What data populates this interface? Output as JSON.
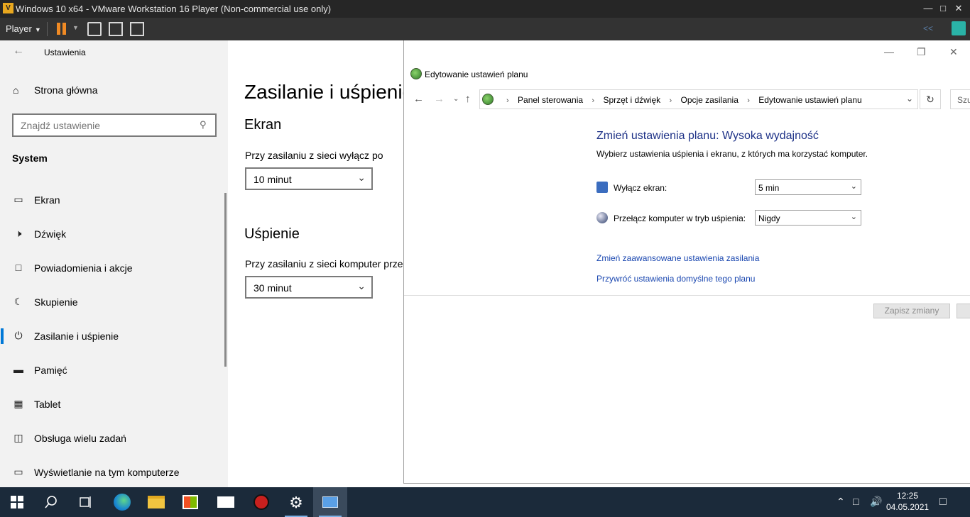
{
  "vmware": {
    "title": "Windows 10 x64 - VMware Workstation 16 Player (Non-commercial use only)",
    "player_menu": "Player",
    "collapse_glyph": "<<"
  },
  "settings": {
    "app_title": "Ustawienia",
    "home": "Strona główna",
    "search_placeholder": "Znajdź ustawienie",
    "section": "System",
    "nav": [
      {
        "label": "Ekran",
        "icon": "monitor-icon"
      },
      {
        "label": "Dźwięk",
        "icon": "speaker-icon"
      },
      {
        "label": "Powiadomienia i akcje",
        "icon": "notification-icon"
      },
      {
        "label": "Skupienie",
        "icon": "moon-icon"
      },
      {
        "label": "Zasilanie i uśpienie",
        "icon": "power-icon",
        "active": true
      },
      {
        "label": "Pamięć",
        "icon": "storage-icon"
      },
      {
        "label": "Tablet",
        "icon": "tablet-icon"
      },
      {
        "label": "Obsługa wielu zadań",
        "icon": "multitasking-icon"
      },
      {
        "label": "Wyświetlanie na tym komputerze",
        "icon": "project-icon"
      }
    ],
    "page_title": "Zasilanie i uśpienie",
    "screen_header": "Ekran",
    "screen_label": "Przy zasilaniu z sieci wyłącz po",
    "screen_value": "10 minut",
    "sleep_header": "Uśpienie",
    "sleep_label": "Przy zasilaniu z sieci komputer przec",
    "sleep_value": "30 minut"
  },
  "control_panel": {
    "window_title": "Edytowanie ustawień planu",
    "breadcrumbs": [
      "Panel sterowania",
      "Sprzęt i dźwięk",
      "Opcje zasilania",
      "Edytowanie ustawień planu"
    ],
    "search_placeholder": "Szu",
    "heading": "Zmień ustawienia planu: Wysoka wydajność",
    "subheading": "Wybierz ustawienia uśpienia i ekranu, z których ma korzystać komputer.",
    "display_off_label": "Wyłącz ekran:",
    "display_off_value": "5 min",
    "sleep_label": "Przełącz komputer w tryb uśpienia:",
    "sleep_value": "Nigdy",
    "link_advanced": "Zmień zaawansowane ustawienia zasilania",
    "link_restore": "Przywróć ustawienia domyślne tego planu",
    "save_button": "Zapisz zmiany"
  },
  "taskbar": {
    "time": "12:25",
    "date": "04.05.2021"
  }
}
